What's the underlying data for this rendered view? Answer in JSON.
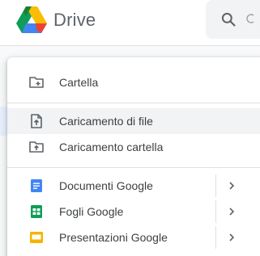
{
  "app": {
    "brand": "Drive",
    "logo_icon": "google-drive-logo"
  },
  "header": {
    "search_icon": "search-icon"
  },
  "new_menu": {
    "items": [
      {
        "label": "Cartella",
        "icon": "new-folder-icon"
      },
      {
        "label": "Caricamento di file",
        "icon": "file-upload-icon"
      },
      {
        "label": "Caricamento cartella",
        "icon": "folder-upload-icon"
      },
      {
        "label": "Documenti Google",
        "icon": "google-docs-icon",
        "has_submenu": true
      },
      {
        "label": "Fogli Google",
        "icon": "google-sheets-icon",
        "has_submenu": true
      },
      {
        "label": "Presentazioni Google",
        "icon": "google-slides-icon",
        "has_submenu": true
      }
    ]
  },
  "colors": {
    "docs": "#4285f4",
    "sheets": "#0f9d58",
    "slides": "#f4b400",
    "icon_gray": "#5f6368",
    "hover": "#f1f3f4"
  }
}
